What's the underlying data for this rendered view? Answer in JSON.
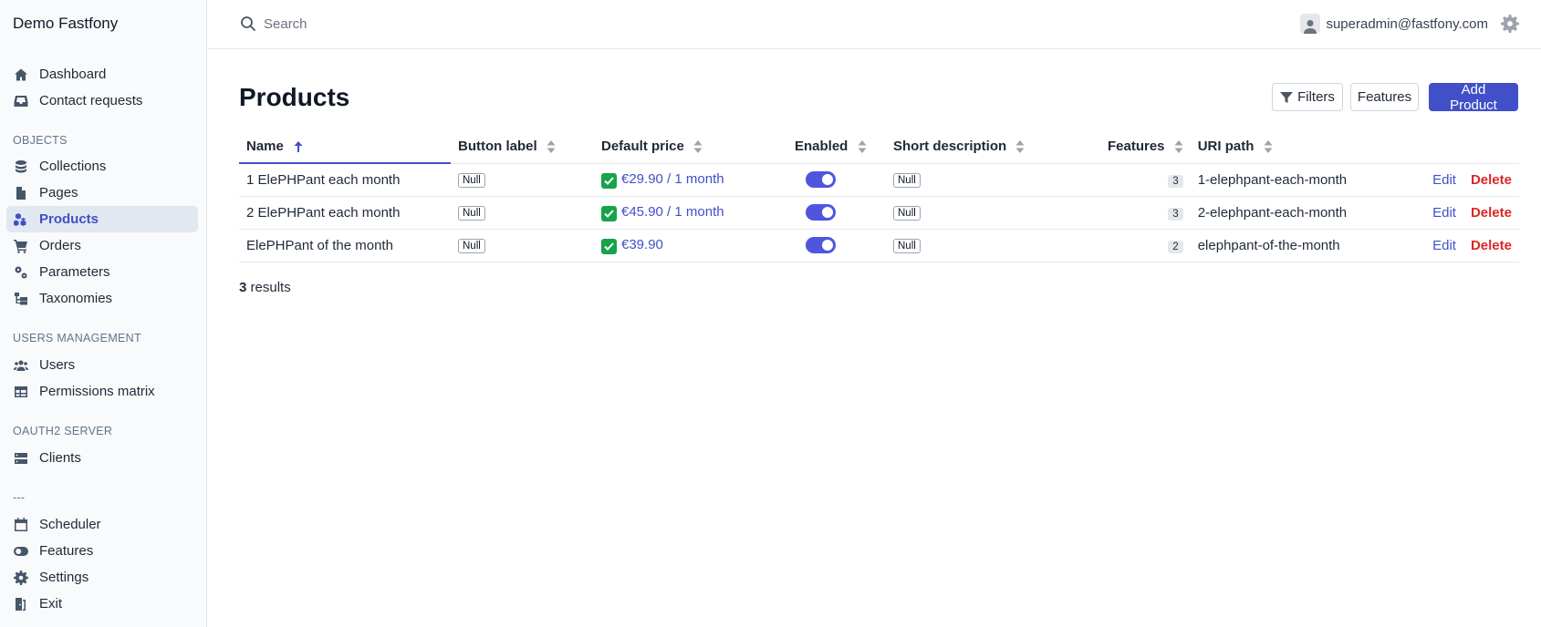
{
  "sidebar": {
    "brand": "Demo Fastfony",
    "items_top": [
      {
        "label": "Dashboard",
        "icon": "home-icon"
      },
      {
        "label": "Contact requests",
        "icon": "inbox-icon"
      }
    ],
    "section_objects": "OBJECTS",
    "items_objects": [
      {
        "label": "Collections",
        "icon": "database-icon"
      },
      {
        "label": "Pages",
        "icon": "file-icon"
      },
      {
        "label": "Products",
        "icon": "cubes-icon"
      },
      {
        "label": "Orders",
        "icon": "cart-icon"
      },
      {
        "label": "Parameters",
        "icon": "gears-icon"
      },
      {
        "label": "Taxonomies",
        "icon": "hierarchy-icon"
      }
    ],
    "section_users": "USERS MANAGEMENT",
    "items_users": [
      {
        "label": "Users",
        "icon": "users-icon"
      },
      {
        "label": "Permissions matrix",
        "icon": "table-icon"
      }
    ],
    "section_oauth": "OAUTH2 SERVER",
    "items_oauth": [
      {
        "label": "Clients",
        "icon": "server-icon"
      }
    ],
    "section_misc": "---",
    "items_misc": [
      {
        "label": "Scheduler",
        "icon": "calendar-icon"
      },
      {
        "label": "Features",
        "icon": "toggle-icon"
      },
      {
        "label": "Settings",
        "icon": "gear-icon"
      },
      {
        "label": "Exit",
        "icon": "door-icon"
      }
    ],
    "active": "Products"
  },
  "header": {
    "search_placeholder": "Search",
    "user_email": "superadmin@fastfony.com"
  },
  "main": {
    "title": "Products",
    "buttons": {
      "filters": "Filters",
      "features": "Features",
      "add": "Add Product"
    },
    "columns": [
      "Name",
      "Button label",
      "Default price",
      "Enabled",
      "Short description",
      "Features",
      "URI path"
    ],
    "rows": [
      {
        "name": "1 ElePHPant each month",
        "button_label": "Null",
        "price": "€29.90 / 1 month",
        "enabled": true,
        "short_description": "Null",
        "features": "3",
        "uri": "1-elephpant-each-month"
      },
      {
        "name": "2 ElePHPant each month",
        "button_label": "Null",
        "price": "€45.90 / 1 month",
        "enabled": true,
        "short_description": "Null",
        "features": "3",
        "uri": "2-elephpant-each-month"
      },
      {
        "name": "ElePHPant of the month",
        "button_label": "Null",
        "price": "€39.90",
        "enabled": true,
        "short_description": "Null",
        "features": "2",
        "uri": "elephpant-of-the-month"
      }
    ],
    "edit_label": "Edit",
    "delete_label": "Delete",
    "results_count": "3",
    "results_label": "results"
  },
  "colors": {
    "accent": "#4150c9",
    "danger": "#dc2626",
    "success": "#16a34a"
  }
}
